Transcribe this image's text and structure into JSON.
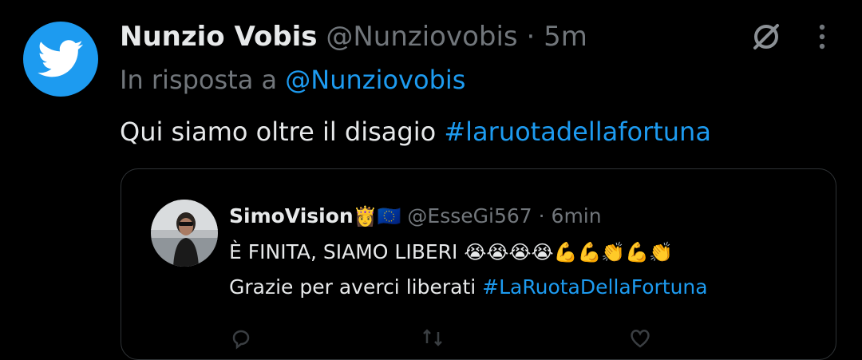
{
  "tweet": {
    "author_name": "Nunzio Vobis",
    "author_handle": "@Nunziovobis",
    "separator": "·",
    "time": "5m",
    "reply_prefix": "In risposta a",
    "reply_handle": "@Nunziovobis",
    "text": "Qui siamo oltre il disagio",
    "hashtag": "#laruotadellafortuna",
    "avatar_icon": "twitter-bird-icon"
  },
  "quoted_tweet": {
    "author_name": "SimoVision",
    "author_badges": "👸🇪🇺",
    "author_handle": "@EsseGi567",
    "separator": "·",
    "time": "6min",
    "line1_text": "È FINITA, SIAMO LIBERI",
    "line1_emojis": "😭😭😭😭💪💪👏💪👏",
    "line2_text": "Grazie per averci liberati",
    "line2_hashtag": "#LaRuotaDellaFortuna"
  },
  "colors": {
    "background": "#000000",
    "text": "#e7e9ea",
    "muted": "#71767b",
    "accent": "#1d9bf0",
    "border": "#2f3336"
  }
}
